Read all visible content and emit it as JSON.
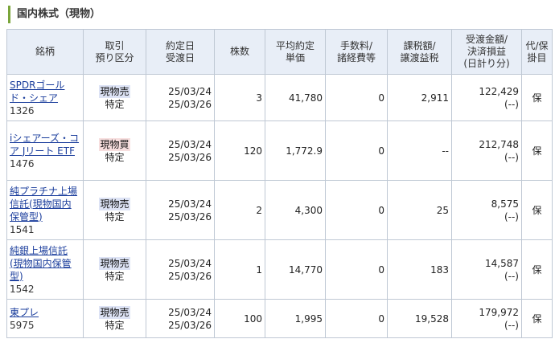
{
  "section": {
    "title": "国内株式（現物）"
  },
  "columns": [
    {
      "line1": "銘柄",
      "line2": ""
    },
    {
      "line1": "取引",
      "line2": "預り区分"
    },
    {
      "line1": "約定日",
      "line2": "受渡日"
    },
    {
      "line1": "株数",
      "line2": ""
    },
    {
      "line1": "平均約定",
      "line2": "単価"
    },
    {
      "line1": "手数料/",
      "line2": "諸経費等"
    },
    {
      "line1": "課税額/",
      "line2": "譲渡益税"
    },
    {
      "line1": "受渡金額/",
      "line2": "決済損益",
      "line3": "(日計り分)"
    },
    {
      "line1": "代/保",
      "line2": "掛目"
    }
  ],
  "rows": [
    {
      "name": "SPDRゴールド・シェア",
      "code": "1326",
      "trade": "現物売",
      "trade_kind": "sell",
      "account": "特定",
      "trade_date": "25/03/24",
      "settle_date": "25/03/26",
      "shares": "3",
      "avg_price": "41,780",
      "fee": "0",
      "tax": "2,911",
      "amount": "122,429",
      "pnl": "(--)",
      "margin": "保"
    },
    {
      "name": "iシェアーズ・コア Jリート ETF",
      "code": "1476",
      "trade": "現物買",
      "trade_kind": "buy",
      "account": "特定",
      "trade_date": "25/03/24",
      "settle_date": "25/03/26",
      "shares": "120",
      "avg_price": "1,772.9",
      "fee": "0",
      "tax": "--",
      "amount": "212,748",
      "pnl": "(--)",
      "margin": "保"
    },
    {
      "name": "純プラチナ上場信託(現物国内保管型)",
      "code": "1541",
      "trade": "現物売",
      "trade_kind": "sell",
      "account": "特定",
      "trade_date": "25/03/24",
      "settle_date": "25/03/26",
      "shares": "2",
      "avg_price": "4,300",
      "fee": "0",
      "tax": "25",
      "amount": "8,575",
      "pnl": "(--)",
      "margin": "保"
    },
    {
      "name": "純銀上場信託(現物国内保管型)",
      "code": "1542",
      "trade": "現物売",
      "trade_kind": "sell",
      "account": "特定",
      "trade_date": "25/03/24",
      "settle_date": "25/03/26",
      "shares": "1",
      "avg_price": "14,770",
      "fee": "0",
      "tax": "183",
      "amount": "14,587",
      "pnl": "(--)",
      "margin": "保"
    },
    {
      "name": "東プレ",
      "code": "5975",
      "trade": "現物売",
      "trade_kind": "sell",
      "account": "特定",
      "trade_date": "25/03/24",
      "settle_date": "25/03/26",
      "shares": "100",
      "avg_price": "1,995",
      "fee": "0",
      "tax": "19,528",
      "amount": "179,972",
      "pnl": "(--)",
      "margin": "保"
    }
  ]
}
